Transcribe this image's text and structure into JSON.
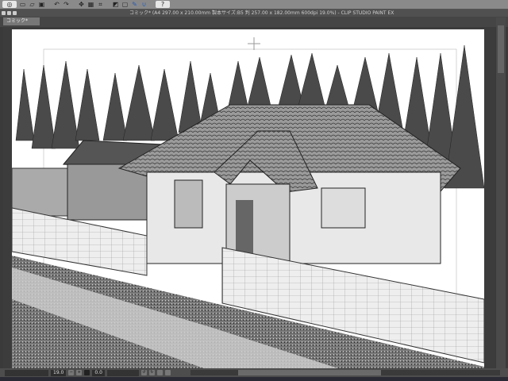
{
  "app": {
    "name": "CLIP STUDIO PAINT EX"
  },
  "toolbar": {
    "icons": [
      "clip-studio-icon",
      "new-icon",
      "open-icon",
      "save-icon",
      "undo-icon",
      "redo-icon",
      "transform-icon",
      "fill-icon",
      "crop-icon",
      "ruler-icon",
      "snap-icon",
      "pen-icon",
      "help-icon"
    ]
  },
  "window": {
    "title": "コミック* (A4 297.00 x 210.00mm 製本サイズ:B5 判 257.00 x 182.00mm 600dpi 19.0%) - CLIP STUDIO PAINT EX"
  },
  "tabs": [
    {
      "label": "コミック*",
      "active": true
    }
  ],
  "status": {
    "zoom": "19.0",
    "angle": "0.0"
  },
  "colors": {
    "chrome": "#8a8a8a",
    "canvas_bg": "#3c3c3c",
    "page": "#ffffff"
  }
}
